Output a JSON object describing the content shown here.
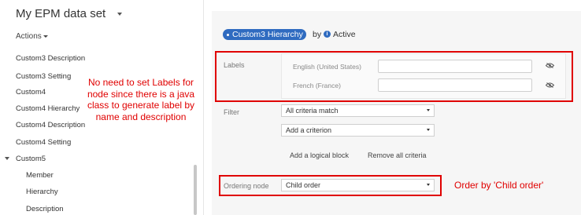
{
  "sidebar": {
    "dataset_title": "My EPM data set",
    "actions_label": "Actions",
    "items": [
      {
        "label": "Custom3 Description"
      },
      {
        "label": "Custom3 Setting"
      },
      {
        "label": "Custom4"
      },
      {
        "label": "Custom4 Hierarchy"
      },
      {
        "label": "Custom4 Description"
      },
      {
        "label": "Custom4 Setting"
      },
      {
        "label": "Custom5"
      },
      {
        "label": "Member"
      },
      {
        "label": "Hierarchy"
      },
      {
        "label": "Description"
      }
    ]
  },
  "annotations": {
    "left_note": "No need to set Labels for node since there is a java class to generate label by name and description",
    "right_note": "Order by 'Child order'"
  },
  "main": {
    "chip_label": "Custom3 Hierarchy",
    "by_text": "by",
    "status": "Active",
    "labels_title": "Labels",
    "languages": [
      {
        "name": "English (United States)",
        "value": ""
      },
      {
        "name": "French (France)",
        "value": ""
      }
    ],
    "filter_title": "Filter",
    "filter_select": "All criteria match",
    "add_criterion": "Add a criterion",
    "add_logical_block": "Add a logical block",
    "remove_all_criteria": "Remove all criteria",
    "ordering_title": "Ordering node",
    "ordering_select": "Child order"
  },
  "colors": {
    "accent": "#2f6bc0",
    "annotation_red": "#e00000"
  }
}
